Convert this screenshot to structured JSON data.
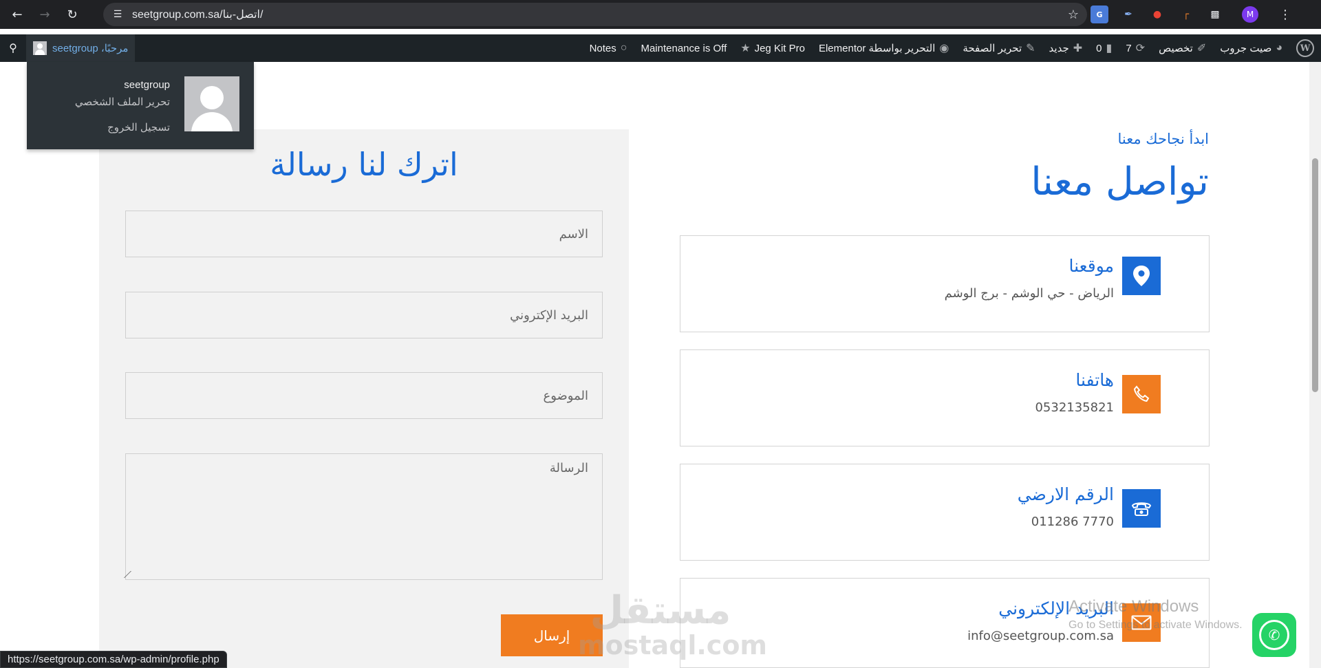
{
  "browser": {
    "url": "seetgroup.com.sa/اتصل-بنا/",
    "icons": [
      "back-icon",
      "forward-icon",
      "reload-icon",
      "site-info-icon",
      "bookmark-star-icon",
      "translate-icon",
      "eyedropper-icon",
      "screen-recorder-icon",
      "frame-extension-icon",
      "extensions-icon",
      "menu-icon"
    ],
    "profile_initial": "M",
    "status_url": "https://seetgroup.com.sa/wp-admin/profile.php"
  },
  "admin_bar": {
    "site_name": "صيت جروب",
    "customize": "تخصيص",
    "updates_count": "7",
    "comments_count": "0",
    "new_label": "جديد",
    "edit_page": "تحرير الصفحة",
    "elementor_edit": "التحرير بواسطة Elementor",
    "jeg_kit": "Jeg Kit Pro",
    "maintenance": "Maintenance is Off",
    "notes": "Notes",
    "greeting": "مرحبًا، seetgroup",
    "account_menu": {
      "username": "seetgroup",
      "edit_profile": "تحرير الملف الشخصي",
      "logout": "تسجيل الخروج"
    }
  },
  "form": {
    "title": "اترك لنا رسالة",
    "name_placeholder": "الاسم",
    "email_placeholder": "البريد الإكتروني",
    "subject_placeholder": "الموضوع",
    "message_placeholder": "الرسالة",
    "submit_label": "إرسال"
  },
  "contact": {
    "tagline": "ابدأ نجاحك معنا",
    "title": "تواصل معنا",
    "cards": [
      {
        "label": "موقعنا",
        "value": "الرياض - حي الوشم - برج الوشم",
        "icon": "location-pin-icon",
        "color": "#1a6bd6"
      },
      {
        "label": "هاتفنا",
        "value": "0532135821",
        "icon": "phone-icon",
        "color": "#f07c20"
      },
      {
        "label": "الرقم الارضي",
        "value": "011286 7770",
        "icon": "landline-phone-icon",
        "color": "#1a6bd6"
      },
      {
        "label": "البريد الإلكتروني",
        "value": "info@seetgroup.com.sa",
        "icon": "email-envelope-icon",
        "color": "#f07c20"
      }
    ]
  },
  "overlays": {
    "watermark_ar": "مستقل",
    "watermark_en": "mostaql.com",
    "activate_title": "Activate Windows",
    "activate_sub": "Go to Settings to activate Windows."
  },
  "colors": {
    "accent_blue": "#1a6bd6",
    "accent_orange": "#f07c20",
    "admin_bar": "#1d2327",
    "whatsapp": "#25d366"
  }
}
